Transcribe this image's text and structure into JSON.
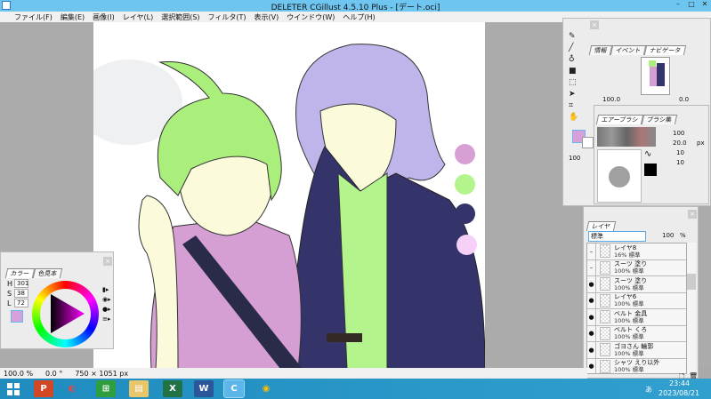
{
  "window": {
    "title": "DELETER CGillust 4.5.10 Plus - [デート.oci]",
    "min": "–",
    "max": "□",
    "close": "✕"
  },
  "menu": [
    "ファイル(F)",
    "編集(E)",
    "画像(I)",
    "レイヤ(L)",
    "選択範囲(S)",
    "フィルタ(T)",
    "表示(V)",
    "ウインドウ(W)",
    "ヘルプ(H)"
  ],
  "status": {
    "zoom": "100.0 %",
    "angle": "0.0 °",
    "size": "750 × 1051 px"
  },
  "palette_colors": [
    "#d89fd4",
    "#b3f58c",
    "#35346a",
    "#f6d0f6"
  ],
  "navigator": {
    "tabs": [
      "情報",
      "イベント",
      "ナビゲータ"
    ],
    "zoom": "100.0",
    "angle": "0.0"
  },
  "brush": {
    "tabs": [
      "エアーブラシ",
      "ブラシ集"
    ],
    "opacity": "100",
    "size": "20.0",
    "size_unit": "px",
    "density": "10",
    "spacing": "10",
    "pct": "%"
  },
  "tools": {
    "opacity": "100"
  },
  "layers": {
    "tab": "レイヤ",
    "blend": "標準",
    "opacity": "100",
    "pct": "%",
    "items": [
      {
        "name": "レイヤ8",
        "sub": "16% 標準",
        "visible": false
      },
      {
        "name": "スーツ 塗り",
        "sub": "100% 標準",
        "visible": false
      },
      {
        "name": "スーツ 塗り",
        "sub": "100% 標準",
        "visible": true
      },
      {
        "name": "レイヤ6",
        "sub": "100% 標準",
        "visible": true
      },
      {
        "name": "ベルト 金具",
        "sub": "100% 標準",
        "visible": true
      },
      {
        "name": "ベルト くろ",
        "sub": "100% 標準",
        "visible": true
      },
      {
        "name": "ゴヨさん 輪郭",
        "sub": "100% 標準",
        "visible": true
      },
      {
        "name": "シャツ えり以外",
        "sub": "100% 標準",
        "visible": true
      }
    ]
  },
  "color": {
    "tabs": [
      "カラー",
      "色見本"
    ],
    "h_label": "H",
    "s_label": "S",
    "l_label": "L",
    "h": "301",
    "s": "38",
    "l": "72",
    "current": "#d8a0d8"
  },
  "taskbar": {
    "apps": [
      "P",
      "◐",
      "⊞",
      "▤",
      "X",
      "W",
      "C",
      "◉"
    ],
    "time": "23:44",
    "date": "2023/08/21",
    "ime": "あ"
  }
}
